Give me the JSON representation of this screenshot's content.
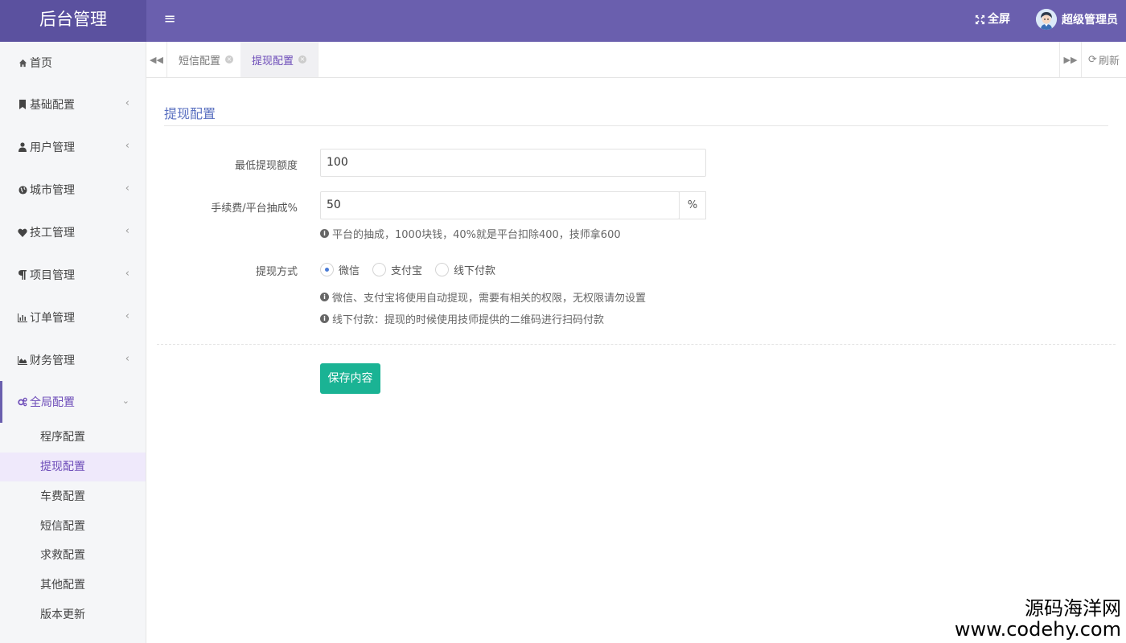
{
  "header": {
    "logo": "后台管理",
    "menu_toggle_glyph": "≡",
    "fullscreen_label": "全屏",
    "user_name": "超级管理员"
  },
  "sidebar": {
    "items": [
      {
        "label": "首页",
        "icon": "home-icon"
      },
      {
        "label": "基础配置",
        "icon": "bookmark-icon"
      },
      {
        "label": "用户管理",
        "icon": "user-icon"
      },
      {
        "label": "城市管理",
        "icon": "globe-icon"
      },
      {
        "label": "技工管理",
        "icon": "heart-icon"
      },
      {
        "label": "项目管理",
        "icon": "paragraph-icon"
      },
      {
        "label": "订单管理",
        "icon": "bar-chart-icon"
      },
      {
        "label": "财务管理",
        "icon": "area-chart-icon"
      },
      {
        "label": "全局配置",
        "icon": "gears-icon"
      }
    ],
    "sub_items": [
      "程序配置",
      "提现配置",
      "车费配置",
      "短信配置",
      "求救配置",
      "其他配置",
      "版本更新"
    ],
    "active_sub": "提现配置"
  },
  "tabs": {
    "items": [
      "短信配置",
      "提现配置"
    ],
    "active": "提现配置",
    "refresh_label": "刷新"
  },
  "form": {
    "title": "提现配置",
    "min_amount_label": "最低提现额度",
    "min_amount_value": "100",
    "fee_label": "手续费/平台抽成%",
    "fee_value": "50",
    "fee_addon": "%",
    "fee_help": "平台的抽成，1000块钱，40%就是平台扣除400，技师拿600",
    "method_label": "提现方式",
    "methods": [
      {
        "label": "微信",
        "checked": true
      },
      {
        "label": "支付宝",
        "checked": false
      },
      {
        "label": "线下付款",
        "checked": false
      }
    ],
    "method_help_1": "微信、支付宝将使用自动提现，需要有相关的权限，无权限请勿设置",
    "method_help_2": "线下付款：提现的时候使用技师提供的二维码进行扫码付款",
    "save_label": "保存内容"
  },
  "watermark": {
    "line1": "源码海洋网",
    "line2": "www.codehy.com"
  },
  "colors": {
    "topbar": "#6a5fae",
    "logo_bg": "#5b519f",
    "accent": "#6c4bb8",
    "save_button": "#1ab394",
    "panel_title": "#5a70c0"
  }
}
